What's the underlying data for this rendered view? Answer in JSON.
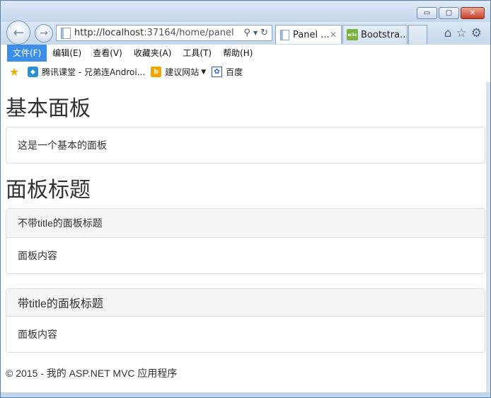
{
  "browser": {
    "address_url_host": "http://localhost",
    "address_url_path": ":37164/home/panel",
    "tabs": [
      {
        "label": "Panel ..."
      },
      {
        "label": "Bootstra..."
      }
    ],
    "window_controls": {
      "minimize": "▭",
      "maximize": "▢",
      "close": "✕"
    },
    "nav_back_icon": "←",
    "nav_fwd_icon": "→",
    "menu": [
      {
        "label": "文件(F)"
      },
      {
        "label": "编辑(E)"
      },
      {
        "label": "查看(V)"
      },
      {
        "label": "收藏夹(A)"
      },
      {
        "label": "工具(T)"
      },
      {
        "label": "帮助(H)"
      }
    ],
    "favorites": [
      {
        "label": "腾讯课堂 - 兄弟连Androi..."
      },
      {
        "label": "建议网站"
      },
      {
        "label": "百度"
      }
    ]
  },
  "page": {
    "heading_basic": "基本面板",
    "basic_panel_body": "这是一个基本的面板",
    "heading_title": "面板标题",
    "panel_no_title": {
      "heading": "不带title的面板标题",
      "body": "面板内容"
    },
    "panel_with_title": {
      "heading": "带title的面板标题",
      "body": "面板内容"
    },
    "footer": "© 2015 - 我的 ASP.NET MVC 应用程序"
  },
  "colors": {
    "accent": "#3c8ee8",
    "panel_border": "#dddddd",
    "panel_heading_bg": "#f5f5f5",
    "text": "#333333"
  }
}
